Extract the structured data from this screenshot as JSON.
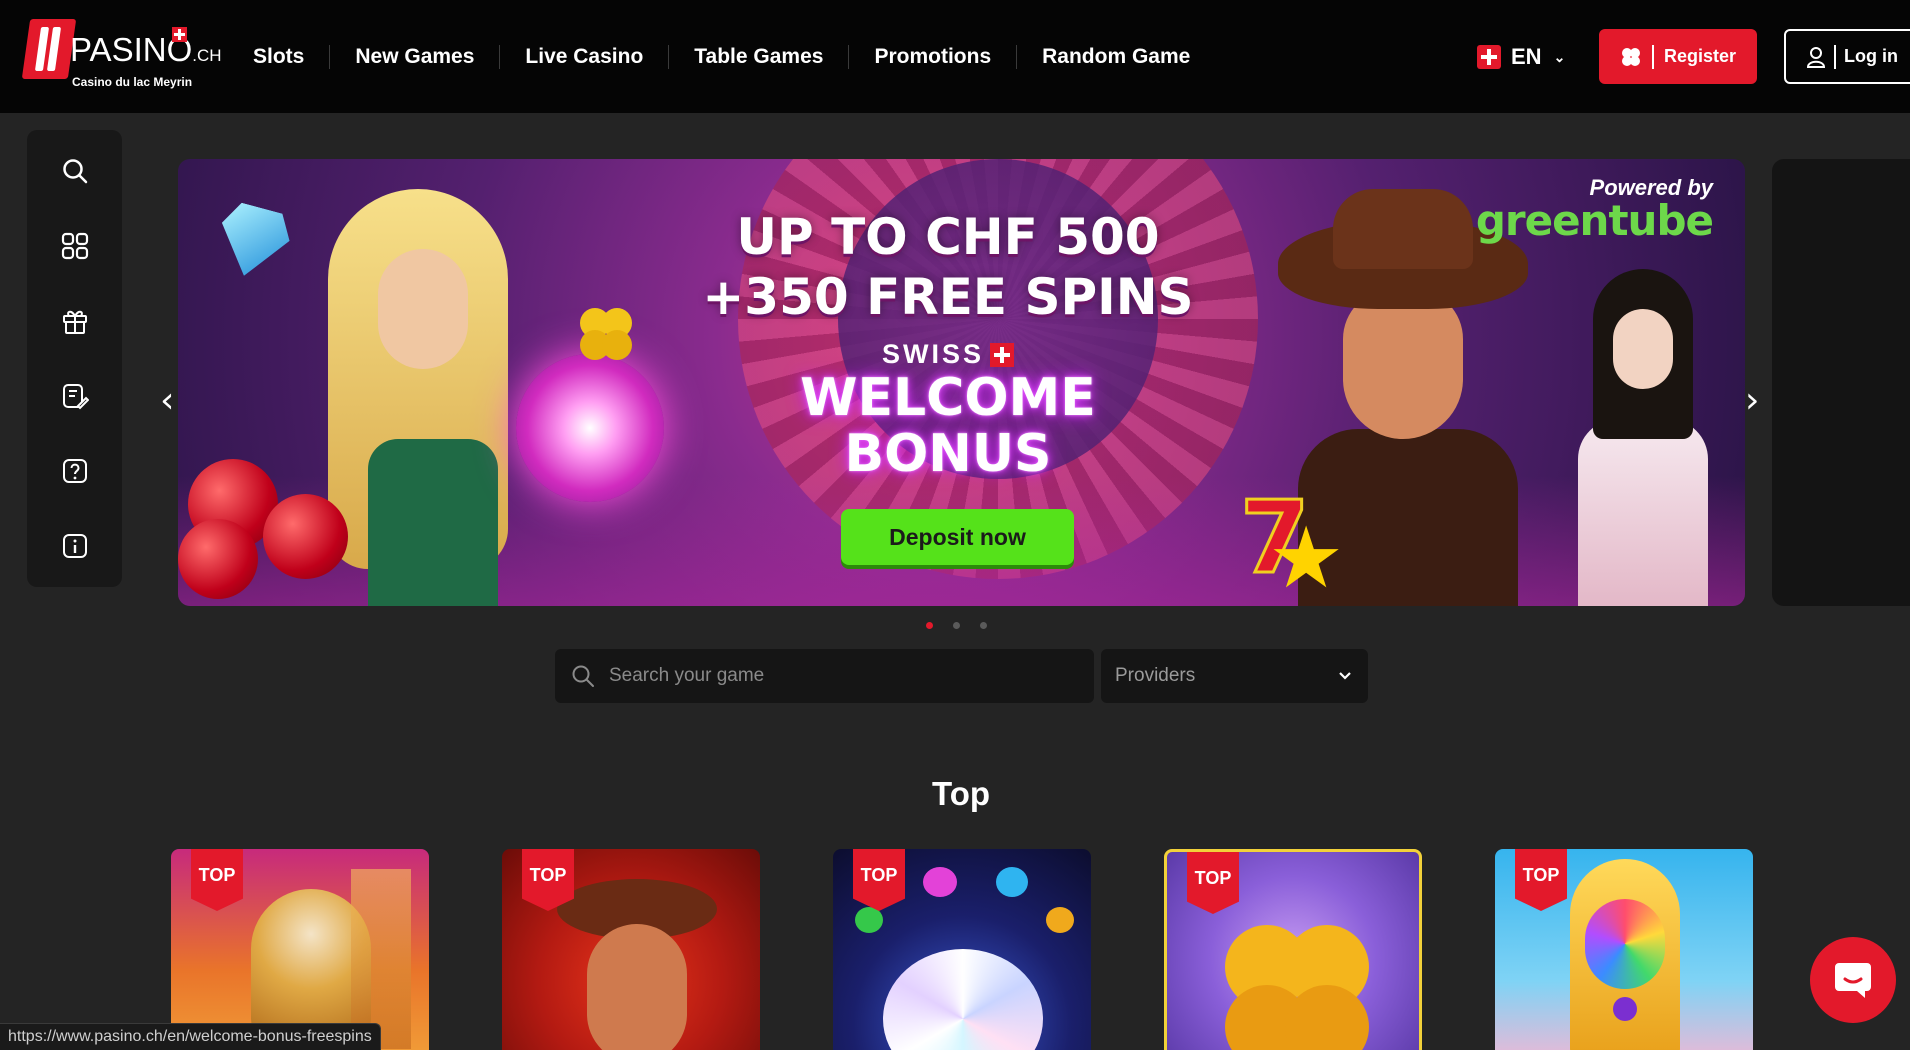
{
  "header": {
    "logo_text": "PASINO",
    "logo_tld": ".CH",
    "logo_subtitle": "Casino du lac Meyrin",
    "nav": [
      "Slots",
      "New Games",
      "Live Casino",
      "Table Games",
      "Promotions",
      "Random Game"
    ],
    "language": "EN",
    "register_label": "Register",
    "login_label": "Log in"
  },
  "sidebar": {
    "icons": [
      "search-icon",
      "grid-icon",
      "gift-icon",
      "notes-icon",
      "help-icon",
      "info-icon"
    ]
  },
  "banner": {
    "headline_line1": "UP TO CHF 500",
    "headline_line2": "+350 FREE SPINS",
    "swiss": "SWISS",
    "welcome": "WELCOME",
    "bonus": "BONUS",
    "cta": "Deposit now",
    "powered_by": "Powered by",
    "brand": "greentube",
    "slides_total": 3,
    "active_slide": 1
  },
  "search": {
    "placeholder": "Search your game",
    "providers_label": "Providers"
  },
  "section": {
    "title": "Top",
    "badge": "TOP",
    "cards": 5
  },
  "status_url": "https://www.pasino.ch/en/welcome-bonus-freespins",
  "colors": {
    "accent": "#e3192b",
    "cta_green": "#55e21a",
    "background": "#242424",
    "header": "#050505"
  }
}
